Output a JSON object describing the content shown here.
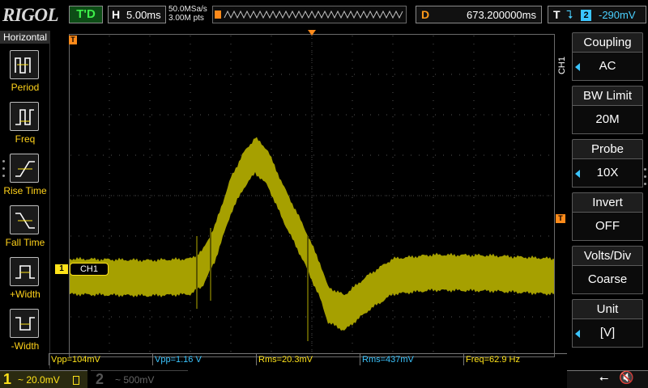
{
  "topbar": {
    "brand": "RIGOL",
    "run_status": "T'D",
    "horizontal": {
      "label": "H",
      "value": "5.00ms"
    },
    "sample_rate": "50.0MSa/s",
    "memory_depth": "3.00M pts",
    "delay": {
      "label": "D",
      "value": "673.200000ms"
    },
    "trigger": {
      "label": "T",
      "icon": "falling-edge-icon",
      "source": "2",
      "level": "-290mV"
    }
  },
  "left_menu": {
    "title": "Horizontal",
    "items": [
      {
        "label": "Period",
        "icon": "period-icon"
      },
      {
        "label": "Freq",
        "icon": "frequency-icon"
      },
      {
        "label": "Rise Time",
        "icon": "rise-time-icon"
      },
      {
        "label": "Fall Time",
        "icon": "fall-time-icon"
      },
      {
        "label": "+Width",
        "icon": "positive-width-icon"
      },
      {
        "label": "-Width",
        "icon": "negative-width-icon"
      }
    ]
  },
  "channel_tag": {
    "number": "1",
    "label": "CH1"
  },
  "side_channel": "CH1",
  "measurements": [
    {
      "text": "Vpp=104mV",
      "channel": 1
    },
    {
      "text": "Vpp=1.16 V",
      "channel": 2
    },
    {
      "text": "Rms=20.3mV",
      "channel": 1
    },
    {
      "text": "Rms=437mV",
      "channel": 2
    },
    {
      "text": "Freq=62.9 Hz",
      "channel": 1
    }
  ],
  "right_menu": [
    {
      "title": "Coupling",
      "value": "AC",
      "has_arrow": true
    },
    {
      "title": "BW Limit",
      "value": "20M",
      "has_arrow": false
    },
    {
      "title": "Probe",
      "value": "10X",
      "has_arrow": true
    },
    {
      "title": "Invert",
      "value": "OFF",
      "has_arrow": false
    },
    {
      "title": "Volts/Div",
      "value": "Coarse",
      "has_arrow": false
    },
    {
      "title": "Unit",
      "value": "[V]",
      "has_arrow": true
    }
  ],
  "bottombar": {
    "ch1": {
      "number": "1",
      "scale": "~ 20.0mV"
    },
    "ch2": {
      "number": "2",
      "scale": "~ 500mV"
    },
    "usb_icon": "usb-icon",
    "speaker_icon": "speaker-muted-icon"
  },
  "colors": {
    "ch1": "#ffe31a",
    "ch2": "#3bc5ff",
    "trigger": "#ff8a1a",
    "trace": "#a6a000"
  }
}
